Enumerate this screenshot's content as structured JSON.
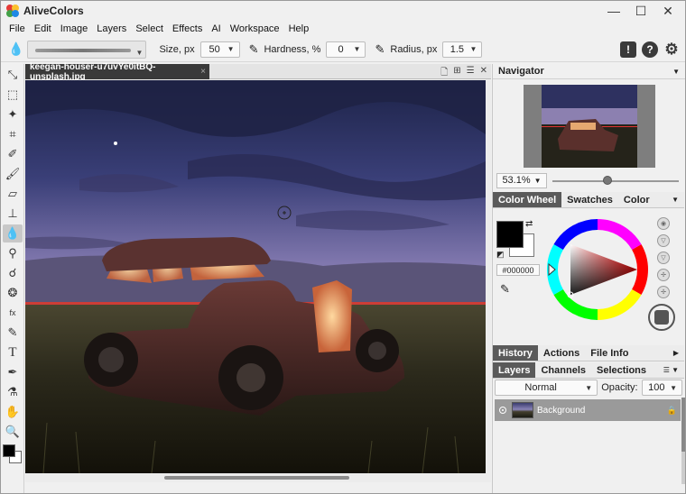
{
  "app": {
    "title": "AliveColors"
  },
  "window_controls": {
    "minimize": "—",
    "maximize": "☐",
    "close": "✕"
  },
  "menu": [
    "File",
    "Edit",
    "Image",
    "Layers",
    "Select",
    "Effects",
    "AI",
    "Workspace",
    "Help"
  ],
  "options": {
    "size_label": "Size, px",
    "size_value": "50",
    "hardness_label": "Hardness, %",
    "hardness_value": "0",
    "radius_label": "Radius, px",
    "radius_value": "1.5"
  },
  "document": {
    "tab_title": "keegan-houser-u7uvYe0itBQ-unsplash.jpg",
    "close": "×"
  },
  "navigator": {
    "title": "Navigator",
    "zoom": "53.1%",
    "zoom_slider": 0.43
  },
  "color_panel": {
    "tabs": [
      "Color Wheel",
      "Swatches",
      "Color"
    ],
    "hex": "#000000",
    "foreground": "#000000",
    "background": "#ffffff"
  },
  "history_tabs": [
    "History",
    "Actions",
    "File Info"
  ],
  "layers_tabs": [
    "Layers",
    "Channels",
    "Selections"
  ],
  "layers": {
    "blend_mode": "Normal",
    "opacity_label": "Opacity:",
    "opacity_value": "100",
    "items": [
      {
        "name": "Background"
      }
    ]
  },
  "tools": [
    "move-icon",
    "marquee-icon",
    "magic-wand-icon",
    "crop-icon",
    "eyedropper-brush-icon",
    "brush-icon",
    "eraser-icon",
    "stamp-icon",
    "blur-drop-icon",
    "dodge-icon",
    "smudge-icon",
    "sponge-icon",
    "fx-brush-icon",
    "pencil-icon",
    "text-icon",
    "pen-icon",
    "color-picker-icon",
    "hand-icon",
    "zoom-icon"
  ]
}
